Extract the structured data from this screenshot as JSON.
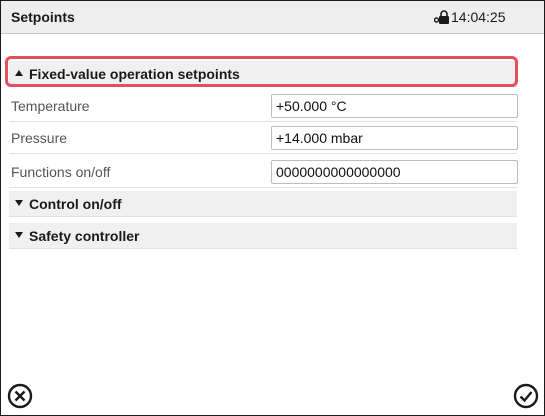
{
  "header": {
    "title": "Setpoints",
    "time": "14:04:25",
    "lock_icon": "lock-icon"
  },
  "sections": {
    "fixed_value": {
      "label": "Fixed-value operation setpoints",
      "expanded": true
    },
    "control": {
      "label": "Control on/off",
      "expanded": false
    },
    "safety": {
      "label": "Safety controller",
      "expanded": false
    }
  },
  "fields": [
    {
      "label": "Temperature",
      "value": "+50.000 °C"
    },
    {
      "label": "Pressure",
      "value": "+14.000 mbar"
    },
    {
      "label": "Functions on/off",
      "value": "0000000000000000"
    }
  ],
  "footer": {
    "cancel_icon": "cancel-circle-icon",
    "confirm_icon": "confirm-check-icon"
  },
  "colors": {
    "highlight": "#e2505e",
    "header_bg": "#eeeeee"
  }
}
